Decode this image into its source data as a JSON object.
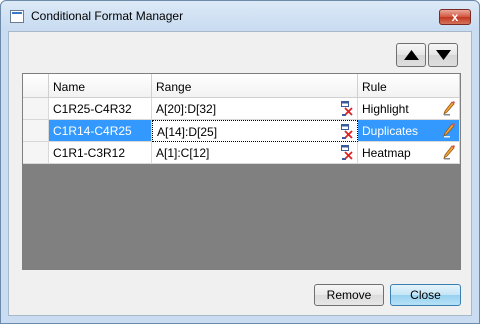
{
  "window": {
    "title": "Conditional Format Manager",
    "close_glyph": "x"
  },
  "toolbar": {
    "move_up_icon": "triangle-up-icon",
    "move_down_icon": "triangle-down-icon"
  },
  "table": {
    "columns": [
      "Name",
      "Range",
      "Rule"
    ],
    "rows": [
      {
        "name": "C1R25-C4R32",
        "range": "A[20]:D[32]",
        "rule": "Highlight"
      },
      {
        "name": "C1R14-C4R25",
        "range": "A[14]:D[25]",
        "rule": "Duplicates"
      },
      {
        "name": "C1R1-C3R12",
        "range": "A[1]:C[12]",
        "rule": "Heatmap"
      }
    ],
    "selected_row_index": 1
  },
  "buttons": {
    "remove": "Remove",
    "close": "Close"
  },
  "colors": {
    "selection": "#3399ff",
    "empty_area": "#808080"
  }
}
